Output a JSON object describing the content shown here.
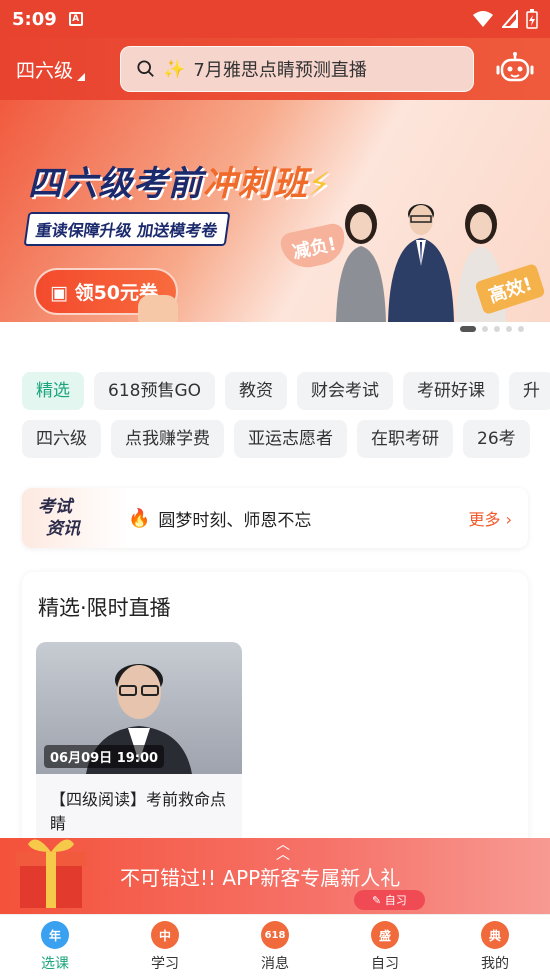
{
  "status_bar": {
    "time": "5:09",
    "app_icon_letter": "A"
  },
  "header": {
    "level_label": "四六级",
    "search": {
      "placeholder": "7月雅思点睛预测直播"
    }
  },
  "banner": {
    "title_main": "四六级考前",
    "title_highlight": "冲刺班",
    "subtitle": "重读保障升级  加送模考卷",
    "cta": "领50元券",
    "badge_left": "减负!",
    "badge_right": "高效!",
    "page_count": 5,
    "active_page": 1
  },
  "chips_row1": [
    "精选",
    "618预售GO",
    "教资",
    "财会考试",
    "考研好课",
    "升"
  ],
  "chips_row2": [
    "四六级",
    "点我赚学费",
    "亚运志愿者",
    "在职考研",
    "26考"
  ],
  "news": {
    "tag_line1": "考试",
    "tag_line2": "资讯",
    "text": "圆梦时刻、师恩不忘",
    "more": "更多"
  },
  "live_section": {
    "title": "精选·限时直播",
    "item": {
      "time": "06月09日 19:00",
      "title": "【四级阅读】考前救命点睛"
    }
  },
  "promo": {
    "text": "不可错过!! APP新客专属新人礼",
    "pill": "自习"
  },
  "tabs": [
    {
      "label": "选课",
      "icon_char": "年",
      "color": "#3aa0f0",
      "active": true
    },
    {
      "label": "学习",
      "icon_char": "中",
      "color": "#f06a3c",
      "active": false
    },
    {
      "label": "消息",
      "icon_char": "618",
      "color": "#f06a3c",
      "active": false
    },
    {
      "label": "自习",
      "icon_char": "盛",
      "color": "#f06a3c",
      "active": false
    },
    {
      "label": "我的",
      "icon_char": "典",
      "color": "#f06a3c",
      "active": false
    }
  ],
  "colors": {
    "brand_red": "#e8432f",
    "accent_green": "#1aa57c",
    "navy": "#1b2a6d"
  }
}
